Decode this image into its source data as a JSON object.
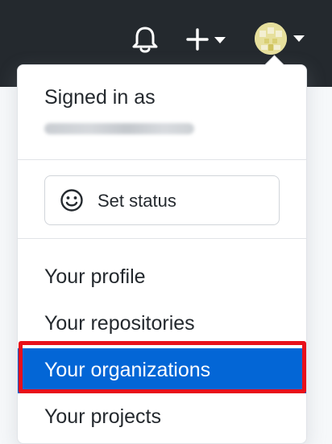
{
  "header": {
    "icons": {
      "notifications": "bell-icon",
      "create": "plus-icon",
      "create_caret": "caret-down-icon",
      "avatar": "user-avatar",
      "avatar_caret": "caret-down-icon"
    }
  },
  "user_menu": {
    "signed_in_label": "Signed in as",
    "status_button": {
      "label": "Set status",
      "icon": "smiley-icon"
    },
    "items": [
      {
        "label": "Your profile",
        "active": false
      },
      {
        "label": "Your repositories",
        "active": false
      },
      {
        "label": "Your organizations",
        "active": true
      },
      {
        "label": "Your projects",
        "active": false
      }
    ]
  },
  "colors": {
    "header_bg": "#24292e",
    "active_item_bg": "#0366d6",
    "highlight_border": "#e8101a"
  }
}
